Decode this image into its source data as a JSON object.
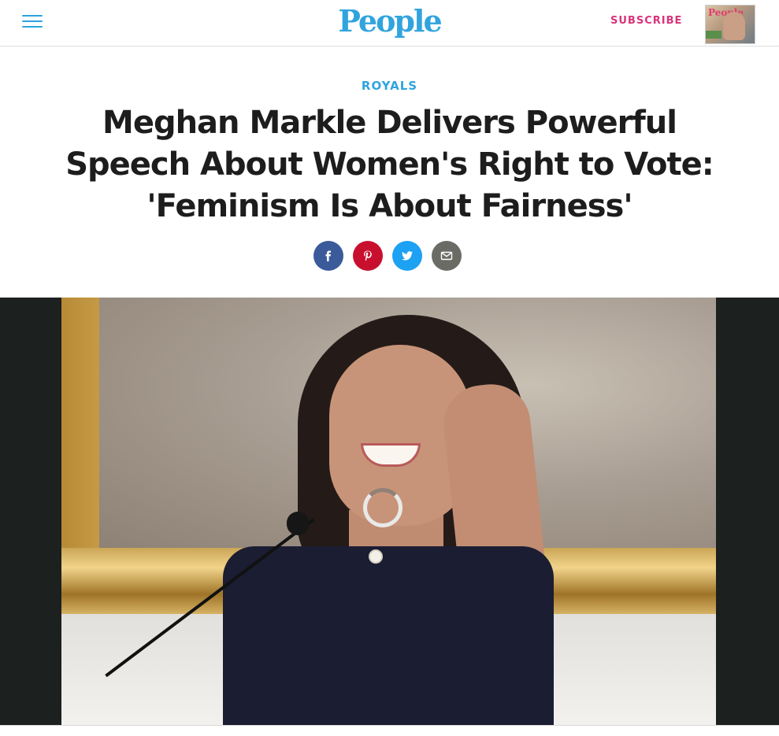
{
  "header": {
    "menu_icon": "hamburger-menu-icon",
    "logo": "People",
    "subscribe_label": "SUBSCRIBE",
    "magazine_cover_masthead": "People",
    "brand_color": "#31a4de",
    "subscribe_color": "#d8347b"
  },
  "article": {
    "category": "ROYALS",
    "headline_lines": [
      "Meghan Markle Delivers Powerful",
      "Speech About Women's Right to Vote:",
      "'Feminism Is About Fairness'"
    ],
    "share_buttons": [
      {
        "name": "facebook",
        "icon": "facebook-icon",
        "color": "#3b5a9a"
      },
      {
        "name": "pinterest",
        "icon": "pinterest-icon",
        "color": "#c8102e"
      },
      {
        "name": "twitter",
        "icon": "twitter-icon",
        "color": "#1da1f2"
      },
      {
        "name": "email",
        "icon": "email-icon",
        "color": "#6b6b66"
      }
    ],
    "hero_loading": true
  }
}
